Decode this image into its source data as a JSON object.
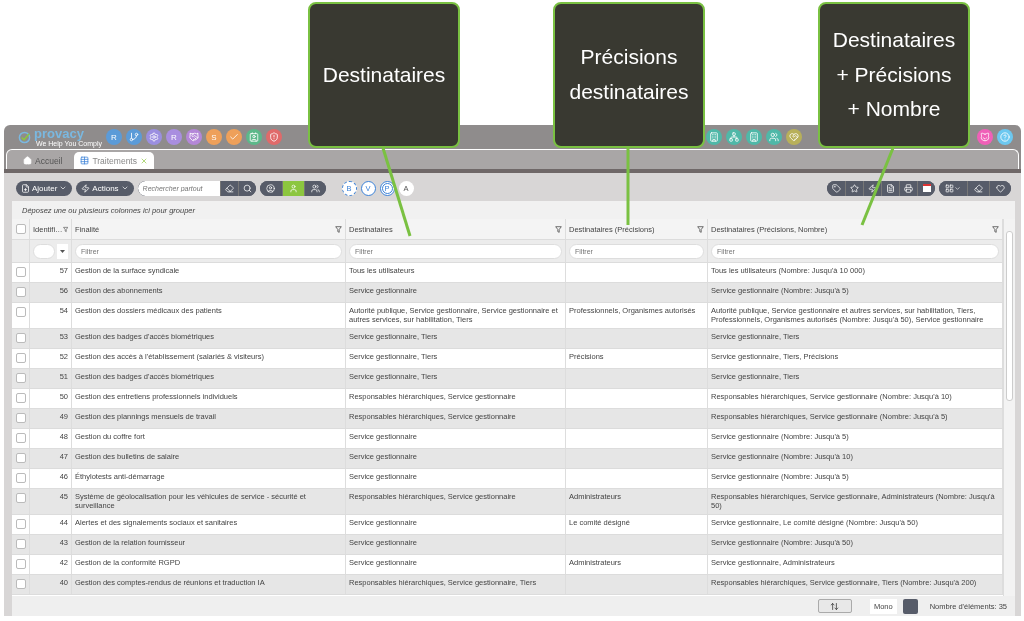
{
  "callouts": [
    {
      "text": "Destinataires"
    },
    {
      "text": "Précisions destinataires"
    },
    {
      "text": "Destinataires + Précisions + Nombre"
    }
  ],
  "logo": {
    "name": "provacy",
    "tagline": "We Help You Comply"
  },
  "modules": [
    {
      "kind": "letter",
      "label": "R",
      "color": "#5b9bd8"
    },
    {
      "kind": "icon",
      "color": "#5b9bd8"
    },
    {
      "kind": "icon",
      "color": "#9b8fe0"
    },
    {
      "kind": "letter",
      "label": "R",
      "color": "#a98ee0"
    },
    {
      "kind": "icon",
      "color": "#b487d8"
    },
    {
      "kind": "letter",
      "label": "S",
      "color": "#eea05a"
    },
    {
      "kind": "icon",
      "color": "#eea05a"
    },
    {
      "kind": "icon",
      "color": "#5cb88a"
    },
    {
      "kind": "icon",
      "color": "#e06a6a"
    },
    {
      "kind": "icon",
      "color": "#4fb8a8"
    },
    {
      "kind": "icon",
      "color": "#4fb8a8"
    },
    {
      "kind": "icon",
      "color": "#4fb8a8"
    },
    {
      "kind": "icon",
      "color": "#4fb8a8"
    },
    {
      "kind": "icon",
      "color": "#b8b05a"
    },
    {
      "kind": "icon",
      "color": "#f060b8"
    },
    {
      "kind": "icon",
      "color": "#6cc8f0"
    }
  ],
  "tabs": [
    {
      "label": "Accueil",
      "selected": false,
      "closable": false
    },
    {
      "label": "Traitements",
      "selected": true,
      "closable": true
    }
  ],
  "select_all": {
    "checked": false
  },
  "toolbar": {
    "add": "Ajouter",
    "actions": "Actions",
    "search": {
      "placeholder": "Rechercher partout"
    }
  },
  "view_buttons": [
    {
      "selected": false
    },
    {
      "selected": true
    },
    {
      "selected": false
    }
  ],
  "letter_filters": [
    {
      "label": "B",
      "kind": "dashed"
    },
    {
      "label": "V",
      "kind": "solid"
    },
    {
      "label": "P",
      "kind": "double"
    },
    {
      "label": "A",
      "kind": "plain"
    }
  ],
  "group_panel": "Déposez une ou plusieurs colonnes ici pour grouper",
  "columns": [
    {
      "label": "Identifi…",
      "kind": "number"
    },
    {
      "label": "Finalité",
      "kind": "text",
      "placeholder": "Filtrer"
    },
    {
      "label": "Destinataires",
      "kind": "text",
      "placeholder": "Filtrer"
    },
    {
      "label": "Destinataires (Précisions)",
      "kind": "text",
      "placeholder": "Filtrer"
    },
    {
      "label": "Destinataires (Précisions, Nombre)",
      "kind": "text",
      "placeholder": "Filtrer"
    }
  ],
  "rows": [
    {
      "checked": false,
      "cells": [
        "57",
        "Gestion de la surface syndicale",
        "Tous les utilisateurs",
        null,
        "Tous les utilisateurs (Nombre: Jusqu'à 10 000)"
      ]
    },
    {
      "checked": false,
      "cells": [
        "56",
        "Gestion des abonnements",
        "Service gestionnaire",
        null,
        "Service gestionnaire (Nombre: Jusqu'à 5)"
      ]
    },
    {
      "checked": false,
      "cells": [
        "54",
        "Gestion des dossiers médicaux des patients",
        "Autorité publique, Service gestionnaire, Service gestionnaire et autres services, sur habilitation, Tiers",
        "Professionnels, Organismes autorisés",
        "Autorité publique, Service gestionnaire et autres services, sur habilitation, Tiers, Professionnels, Organismes autorisés (Nombre: Jusqu'à 50), Service gestionnaire"
      ]
    },
    {
      "checked": false,
      "cells": [
        "53",
        "Gestion des badges d'accès biométriques",
        "Service gestionnaire, Tiers",
        null,
        "Service gestionnaire, Tiers"
      ]
    },
    {
      "checked": false,
      "cells": [
        "52",
        "Gestion des accès à l'établissement (salariés & visiteurs)",
        "Service gestionnaire, Tiers",
        "Précisions",
        "Service gestionnaire, Tiers, Précisions"
      ]
    },
    {
      "checked": false,
      "cells": [
        "51",
        "Gestion des badges d'accès biométriques",
        "Service gestionnaire, Tiers",
        null,
        "Service gestionnaire, Tiers"
      ]
    },
    {
      "checked": false,
      "cells": [
        "50",
        "Gestion des entretiens professionnels individuels",
        "Responsables hiérarchiques, Service gestionnaire",
        null,
        "Responsables hiérarchiques, Service gestionnaire (Nombre: Jusqu'à 10)"
      ]
    },
    {
      "checked": false,
      "cells": [
        "49",
        "Gestion des plannings mensuels de travail",
        "Responsables hiérarchiques, Service gestionnaire",
        null,
        "Responsables hiérarchiques, Service gestionnaire (Nombre: Jusqu'à 5)"
      ]
    },
    {
      "checked": false,
      "cells": [
        "48",
        "Gestion du coffre fort",
        "Service gestionnaire",
        null,
        "Service gestionnaire (Nombre: Jusqu'à 5)"
      ]
    },
    {
      "checked": false,
      "cells": [
        "47",
        "Gestion des bulletins de salaire",
        "Service gestionnaire",
        null,
        "Service gestionnaire (Nombre: Jusqu'à 10)"
      ]
    },
    {
      "checked": false,
      "cells": [
        "46",
        "Éthylotests anti-démarrage",
        "Service gestionnaire",
        null,
        "Service gestionnaire (Nombre: Jusqu'à 5)"
      ]
    },
    {
      "checked": false,
      "cells": [
        "45",
        "Système de géolocalisation pour les véhicules de service - sécurité et surveillance",
        "Responsables hiérarchiques, Service gestionnaire",
        "Administrateurs",
        "Responsables hiérarchiques, Service gestionnaire, Administrateurs (Nombre: Jusqu'à 50)"
      ]
    },
    {
      "checked": false,
      "cells": [
        "44",
        "Alertes et des signalements sociaux et sanitaires",
        "Service gestionnaire",
        "Le comité désigné",
        "Service gestionnaire, Le comité désigné (Nombre: Jusqu'à 50)"
      ]
    },
    {
      "checked": false,
      "cells": [
        "43",
        "Gestion de la relation fournisseur",
        "Service gestionnaire",
        null,
        "Service gestionnaire (Nombre: Jusqu'à 50)"
      ]
    },
    {
      "checked": false,
      "cells": [
        "42",
        "Gestion de la conformité RGPD",
        "Service gestionnaire",
        "Administrateurs",
        "Service gestionnaire, Administrateurs"
      ]
    },
    {
      "checked": false,
      "cells": [
        "40",
        "Gestion des comptes-rendus de réunions et traduction IA",
        "Responsables hiérarchiques, Service gestionnaire, Tiers",
        null,
        "Responsables hiérarchiques, Service gestionnaire, Tiers (Nombre: Jusqu'à 200)"
      ]
    }
  ],
  "footer": {
    "mono": "Mono",
    "count": "Nombre d'éléments: 35"
  }
}
